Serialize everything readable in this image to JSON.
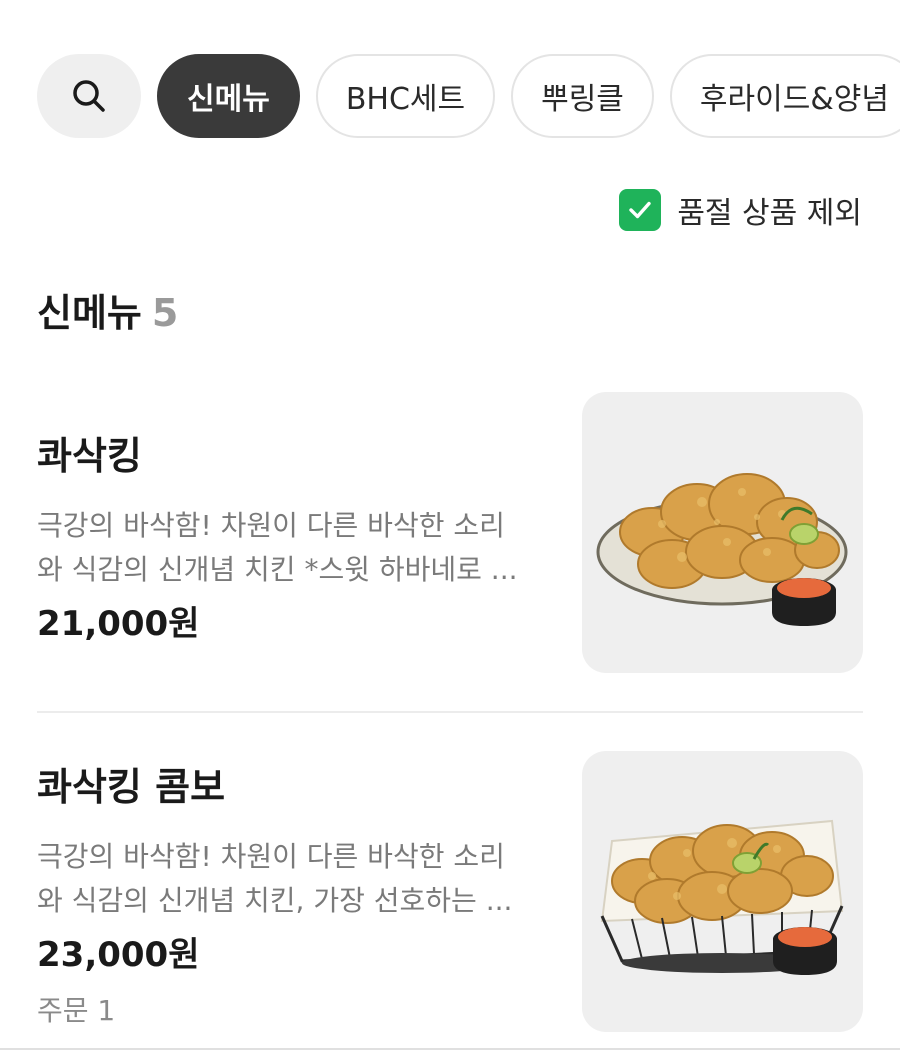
{
  "categories": {
    "search_icon": "search-icon",
    "chips": [
      "신메뉴",
      "BHC세트",
      "뿌링클",
      "후라이드&양념"
    ],
    "active_index": 0
  },
  "filter": {
    "label": "품절 상품 제외",
    "checked": true,
    "checkbox_color": "#1fb35a"
  },
  "section": {
    "title": "신메뉴",
    "count": "5"
  },
  "items": [
    {
      "name": "콰삭킹",
      "desc_line1": "극강의 바삭함! 차원이 다른 바삭한 소리",
      "desc_line2": "와 식감의 신개념 치킨 *스윗 하바네로 ...",
      "price": "21,000원",
      "orders": "",
      "photo": "crispy-chicken-plate-photo"
    },
    {
      "name": "콰삭킹 콤보",
      "desc_line1": "극강의 바삭함! 차원이 다른 바삭한 소리",
      "desc_line2": "와 식감의 신개념 치킨, 가장 선호하는 ...",
      "price": "23,000원",
      "orders": "주문 1",
      "photo": "crispy-chicken-basket-photo"
    }
  ],
  "colors": {
    "active_chip": "#3a3a3a",
    "accent_green": "#1fb35a",
    "muted_text": "#7a7a7a"
  }
}
